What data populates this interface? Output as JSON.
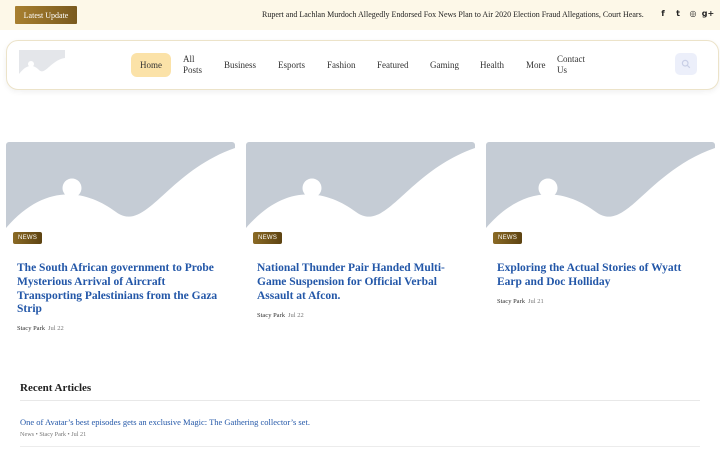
{
  "topbar": {
    "latest_label": "Latest Update",
    "ticker_text": "Rupert and Lachlan Murdoch Allegedly Endorsed Fox News Plan to Air 2020 Election Fraud Allegations, Court Hears.",
    "socials": [
      {
        "icon": "facebook-icon",
        "glyph": "f"
      },
      {
        "icon": "twitter-icon",
        "glyph": "t"
      },
      {
        "icon": "instagram-icon",
        "glyph": "◎"
      },
      {
        "icon": "google-plus-icon",
        "glyph": "g+"
      }
    ]
  },
  "nav": {
    "items": [
      {
        "label": "Home",
        "active": true
      },
      {
        "label": "All Posts"
      },
      {
        "label": "Business"
      },
      {
        "label": "Esports"
      },
      {
        "label": "Fashion"
      },
      {
        "label": "Featured"
      },
      {
        "label": "Gaming"
      },
      {
        "label": "Health"
      },
      {
        "label": "More"
      },
      {
        "label": "Contact Us"
      }
    ]
  },
  "search": {
    "icon": "search-icon"
  },
  "cards": [
    {
      "badge": "NEWS",
      "title": "The South African government to Probe Mysterious Arrival of Aircraft Transporting Palestinians from the Gaza Strip",
      "author": "Stacy Park",
      "date": "Jul 22"
    },
    {
      "badge": "NEWS",
      "title": "National Thunder Pair Handed Multi-Game Suspension for Official Verbal Assault at Afcon.",
      "author": "Stacy Park",
      "date": "Jul 22"
    },
    {
      "badge": "NEWS",
      "title": "Exploring the Actual Stories of Wyatt Earp and Doc Holliday",
      "author": "Stacy Park",
      "date": "Jul 21"
    }
  ],
  "recent": {
    "heading": "Recent Articles",
    "items": [
      {
        "title": "One of Avatar’s best episodes gets an exclusive Magic: The Gathering collector’s set.",
        "meta": "News • Stacy Park • Jul 21"
      }
    ]
  },
  "colors": {
    "accent": "#fbe2a8",
    "link": "#2357a8",
    "badge": "#8a6a25",
    "topbar_bg": "#fdf8e8"
  }
}
